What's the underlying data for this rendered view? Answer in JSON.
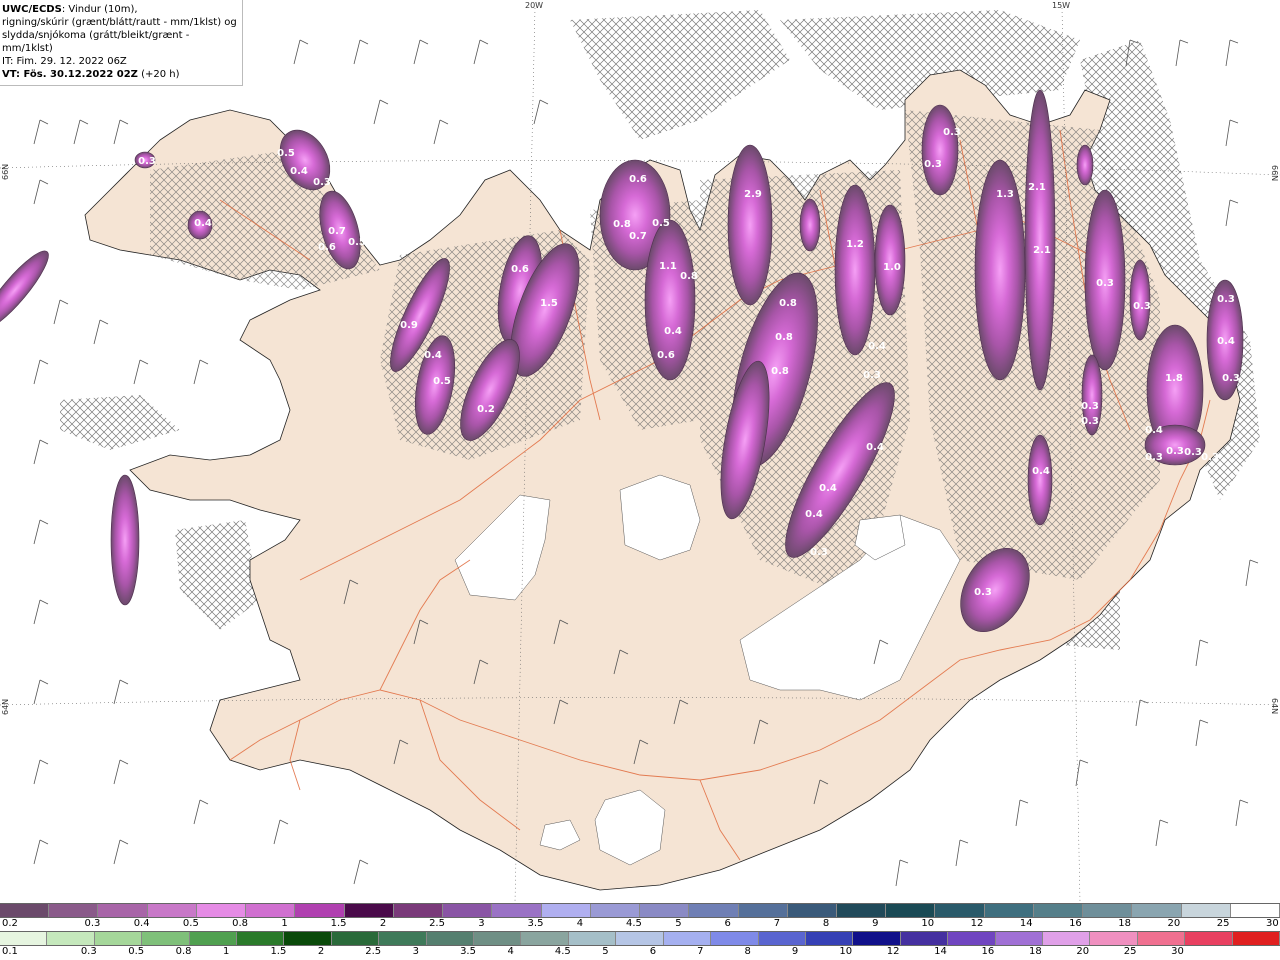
{
  "header": {
    "model": "UWC/ECDS",
    "line1": ": Vindur (10m),",
    "line2": "rigning/skúrir (grænt/blátt/rautt - mm/1klst) og",
    "line3": "slydda/snjókoma (grátt/bleikt/grænt - mm/1klst)",
    "it": "IT: Fim. 29. 12. 2022 06Z",
    "vt_label": "VT: Fös. 30.12.2022 02Z",
    "vt_lead": " (+20 h)"
  },
  "map_labels": {
    "lon_20w": "20W",
    "lon_15w": "15W",
    "lat_left_66": "66N",
    "lat_right_66": "66N",
    "lat_left_64": "64N",
    "lat_right_64": "64N"
  },
  "precip_values": [
    {
      "v": "0.3"
    },
    {
      "v": "0.5"
    },
    {
      "v": "0.4"
    },
    {
      "v": "0.3"
    },
    {
      "v": "0.4"
    },
    {
      "v": "0.7"
    },
    {
      "v": "0.6"
    },
    {
      "v": "0.5"
    },
    {
      "v": "0.9"
    },
    {
      "v": "0.4"
    },
    {
      "v": "0.5"
    },
    {
      "v": "0.6"
    },
    {
      "v": "1.5"
    },
    {
      "v": "0.2"
    },
    {
      "v": "0.6"
    },
    {
      "v": "0.8"
    },
    {
      "v": "0.7"
    },
    {
      "v": "0.5"
    },
    {
      "v": "1.1"
    },
    {
      "v": "0.8"
    },
    {
      "v": "0.4"
    },
    {
      "v": "0.6"
    },
    {
      "v": "2.9"
    },
    {
      "v": "0.8"
    },
    {
      "v": "0.8"
    },
    {
      "v": "0.8"
    },
    {
      "v": "1.2"
    },
    {
      "v": "1.0"
    },
    {
      "v": "0.4"
    },
    {
      "v": "0.3"
    },
    {
      "v": "0.4"
    },
    {
      "v": "0.4"
    },
    {
      "v": "0.4"
    },
    {
      "v": "0.3"
    },
    {
      "v": "0.3"
    },
    {
      "v": "0.3"
    },
    {
      "v": "1.3"
    },
    {
      "v": "2.1"
    },
    {
      "v": "2.1"
    },
    {
      "v": "0.3"
    },
    {
      "v": "0.3"
    },
    {
      "v": "0.3"
    },
    {
      "v": "0.3"
    },
    {
      "v": "0.3"
    },
    {
      "v": "1.8"
    },
    {
      "v": "0.4"
    },
    {
      "v": "0.3"
    },
    {
      "v": "0.3"
    },
    {
      "v": "0.3"
    },
    {
      "v": "0.3"
    },
    {
      "v": "0.4"
    },
    {
      "v": "0.3"
    },
    {
      "v": "0.4"
    },
    {
      "v": "0.3"
    }
  ],
  "legend_snow": {
    "colors": [
      "#6b4a6b",
      "#8a5a8a",
      "#a865a8",
      "#c878c8",
      "#e58be5",
      "#d070d0",
      "#b040b0",
      "#4a0a4a",
      "#7a3a7a",
      "#8a55a5",
      "#9a72c5",
      "#b0aff0",
      "#9a9ad5",
      "#8a8ac5",
      "#6f7fb5",
      "#55709a",
      "#3a5a7a",
      "#214a5a",
      "#1a4a55",
      "#2a5a6a",
      "#3f6f7f",
      "#557f8a",
      "#6f8f9a",
      "#8aa5b0",
      "#c8d5dc",
      "#ffffff"
    ],
    "labels": [
      "0.2",
      "0.3",
      "0.4",
      "0.5",
      "0.8",
      "1",
      "1.5",
      "2",
      "2.5",
      "3",
      "3.5",
      "4",
      "4.5",
      "5",
      "6",
      "7",
      "8",
      "9",
      "10",
      "12",
      "14",
      "16",
      "18",
      "20",
      "25",
      "30"
    ]
  },
  "legend_rain": {
    "colors": [
      "#e6f5e0",
      "#c5e8bc",
      "#a5d79a",
      "#7fc07a",
      "#50a050",
      "#2a7a2a",
      "#0a4a0a",
      "#2a6a3a",
      "#3f7a5a",
      "#557f6f",
      "#6f8f85",
      "#8aa59f",
      "#a5bfc8",
      "#b5c5e5",
      "#a5b0f0",
      "#7f8ae8",
      "#5a65d0",
      "#3540b5",
      "#10108a",
      "#4530a0",
      "#7045c0",
      "#a070d5",
      "#e0a0e8",
      "#f090c0",
      "#f07090",
      "#e84060",
      "#e02020"
    ],
    "labels": [
      "0.1",
      "0.3",
      "0.5",
      "0.8",
      "1",
      "1.5",
      "2",
      "2.5",
      "3",
      "3.5",
      "4",
      "4.5",
      "5",
      "6",
      "7",
      "8",
      "9",
      "10",
      "12",
      "14",
      "16",
      "18",
      "20",
      "25",
      "30"
    ]
  }
}
